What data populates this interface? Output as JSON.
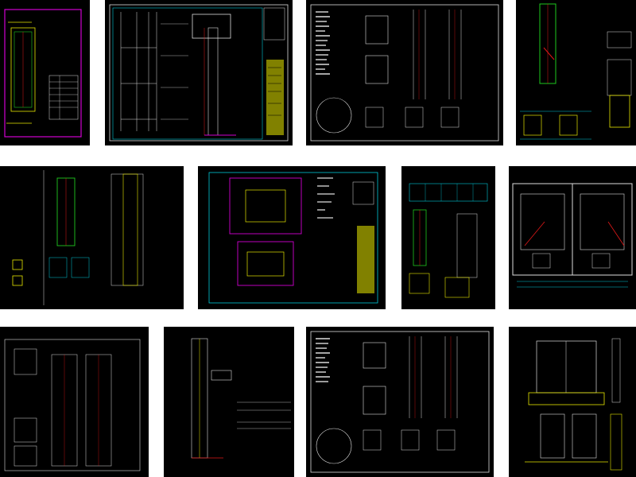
{
  "gallery": {
    "items": [
      {
        "id": "sheet-01",
        "label": ""
      },
      {
        "id": "sheet-02",
        "label": ""
      },
      {
        "id": "sheet-03",
        "label": ""
      },
      {
        "id": "sheet-04",
        "label": ""
      },
      {
        "id": "sheet-05",
        "label": ""
      },
      {
        "id": "sheet-06",
        "label": ""
      },
      {
        "id": "sheet-07",
        "label": ""
      },
      {
        "id": "sheet-08",
        "label": ""
      },
      {
        "id": "sheet-09",
        "label": ""
      },
      {
        "id": "sheet-10",
        "label": ""
      },
      {
        "id": "sheet-11",
        "label": ""
      },
      {
        "id": "sheet-12",
        "label": ""
      }
    ]
  },
  "colors": {
    "background": "#000000",
    "frame_white": "#e8e8e8",
    "frame_magenta": "#d000d0",
    "line_green": "#1ec81e",
    "line_cyan": "#00c8d8",
    "line_yellow": "#e6e600",
    "line_red": "#e01818",
    "line_white": "#dcdcdc"
  }
}
